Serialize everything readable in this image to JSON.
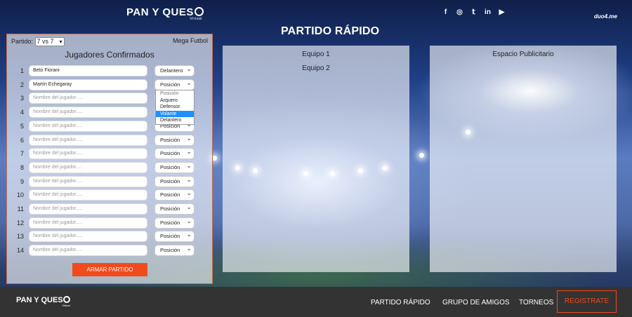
{
  "header": {
    "brand": "PAN Y QUES",
    "brand_sub": "Virtual",
    "socials": [
      "f",
      "◎",
      "𝕥",
      "in",
      "▶"
    ],
    "social_icons": [
      "facebook-icon",
      "instagram-icon",
      "twitter-icon",
      "linkedin-icon",
      "youtube-icon"
    ],
    "corner_logo": "duo4.me",
    "title": "PARTIDO RÁPIDO"
  },
  "form": {
    "partido_label": "Partido:",
    "partido_value": "7 vs 7",
    "mega_label": "Mega Futbol",
    "title": "Jugadores Confirmados",
    "name_placeholder": "Nombre del jugador.....",
    "position_placeholder": "Posición",
    "players": [
      {
        "num": "1",
        "name": "Beto Fiorani",
        "position": "Delantero"
      },
      {
        "num": "2",
        "name": "Martín Echegaray",
        "position": "Posición"
      },
      {
        "num": "3",
        "name": "",
        "position": "Posición"
      },
      {
        "num": "4",
        "name": "",
        "position": "Posición"
      },
      {
        "num": "5",
        "name": "",
        "position": "Posición"
      },
      {
        "num": "6",
        "name": "",
        "position": "Posición"
      },
      {
        "num": "7",
        "name": "",
        "position": "Posición"
      },
      {
        "num": "8",
        "name": "",
        "position": "Posición"
      },
      {
        "num": "9",
        "name": "",
        "position": "Posición"
      },
      {
        "num": "10",
        "name": "",
        "position": "Posición"
      },
      {
        "num": "11",
        "name": "",
        "position": "Posición"
      },
      {
        "num": "12",
        "name": "",
        "position": "Posición"
      },
      {
        "num": "13",
        "name": "",
        "position": "Posición"
      },
      {
        "num": "14",
        "name": "",
        "position": "Posición"
      }
    ],
    "dropdown_options": [
      "Posición",
      "Arquero",
      "Defensor",
      "Volante",
      "Delantero"
    ],
    "dropdown_highlighted": "Volante",
    "submit_label": "ARMAR PARTIDO"
  },
  "teams": {
    "team1": "Equipo 1",
    "team2": "Equipo 2"
  },
  "ad": {
    "label": "Espacio Publicitario"
  },
  "footer": {
    "brand": "PAN Y QUES",
    "brand_sub": "Virtual",
    "nav": [
      "PARTIDO RÁPIDO",
      "GRUPO DE AMIGOS",
      "TORNEOS"
    ],
    "register_label": "REGISTRATE"
  },
  "colors": {
    "accent": "#f04a1d",
    "footer_bg": "#333333",
    "highlight": "#1e90ff"
  }
}
